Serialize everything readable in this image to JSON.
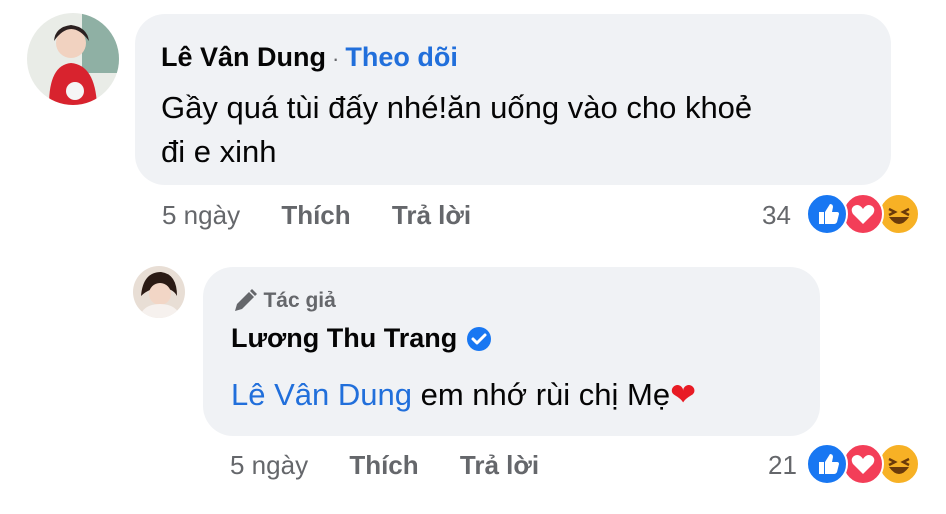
{
  "comment": {
    "author": "Lê Vân Dung",
    "separator": "·",
    "follow_label": "Theo dõi",
    "text_line1": "Gầy quá tùi đấy nhé!ăn uống vào cho khoẻ",
    "text_line2": "đi e xinh",
    "time": "5 ngày",
    "like_label": "Thích",
    "reply_label": "Trả lời",
    "reaction_count": "34",
    "reactions": [
      "like-icon",
      "love-icon",
      "haha-icon"
    ]
  },
  "reply": {
    "author_tag": "Tác giả",
    "author": "Lương Thu Trang",
    "verified": true,
    "mention": "Lê Vân Dung",
    "text": "em nhớ rùi chị Mẹ",
    "emoji": "❤️",
    "time": "5 ngày",
    "like_label": "Thích",
    "reply_label": "Trả lời",
    "reaction_count": "21",
    "reactions": [
      "like-icon",
      "love-icon",
      "haha-icon"
    ]
  },
  "colors": {
    "bubble": "#f0f2f5",
    "link": "#216fdb",
    "meta": "#65676b",
    "like": "#1877f2",
    "love": "#f33e58",
    "haha": "#f7b125"
  }
}
